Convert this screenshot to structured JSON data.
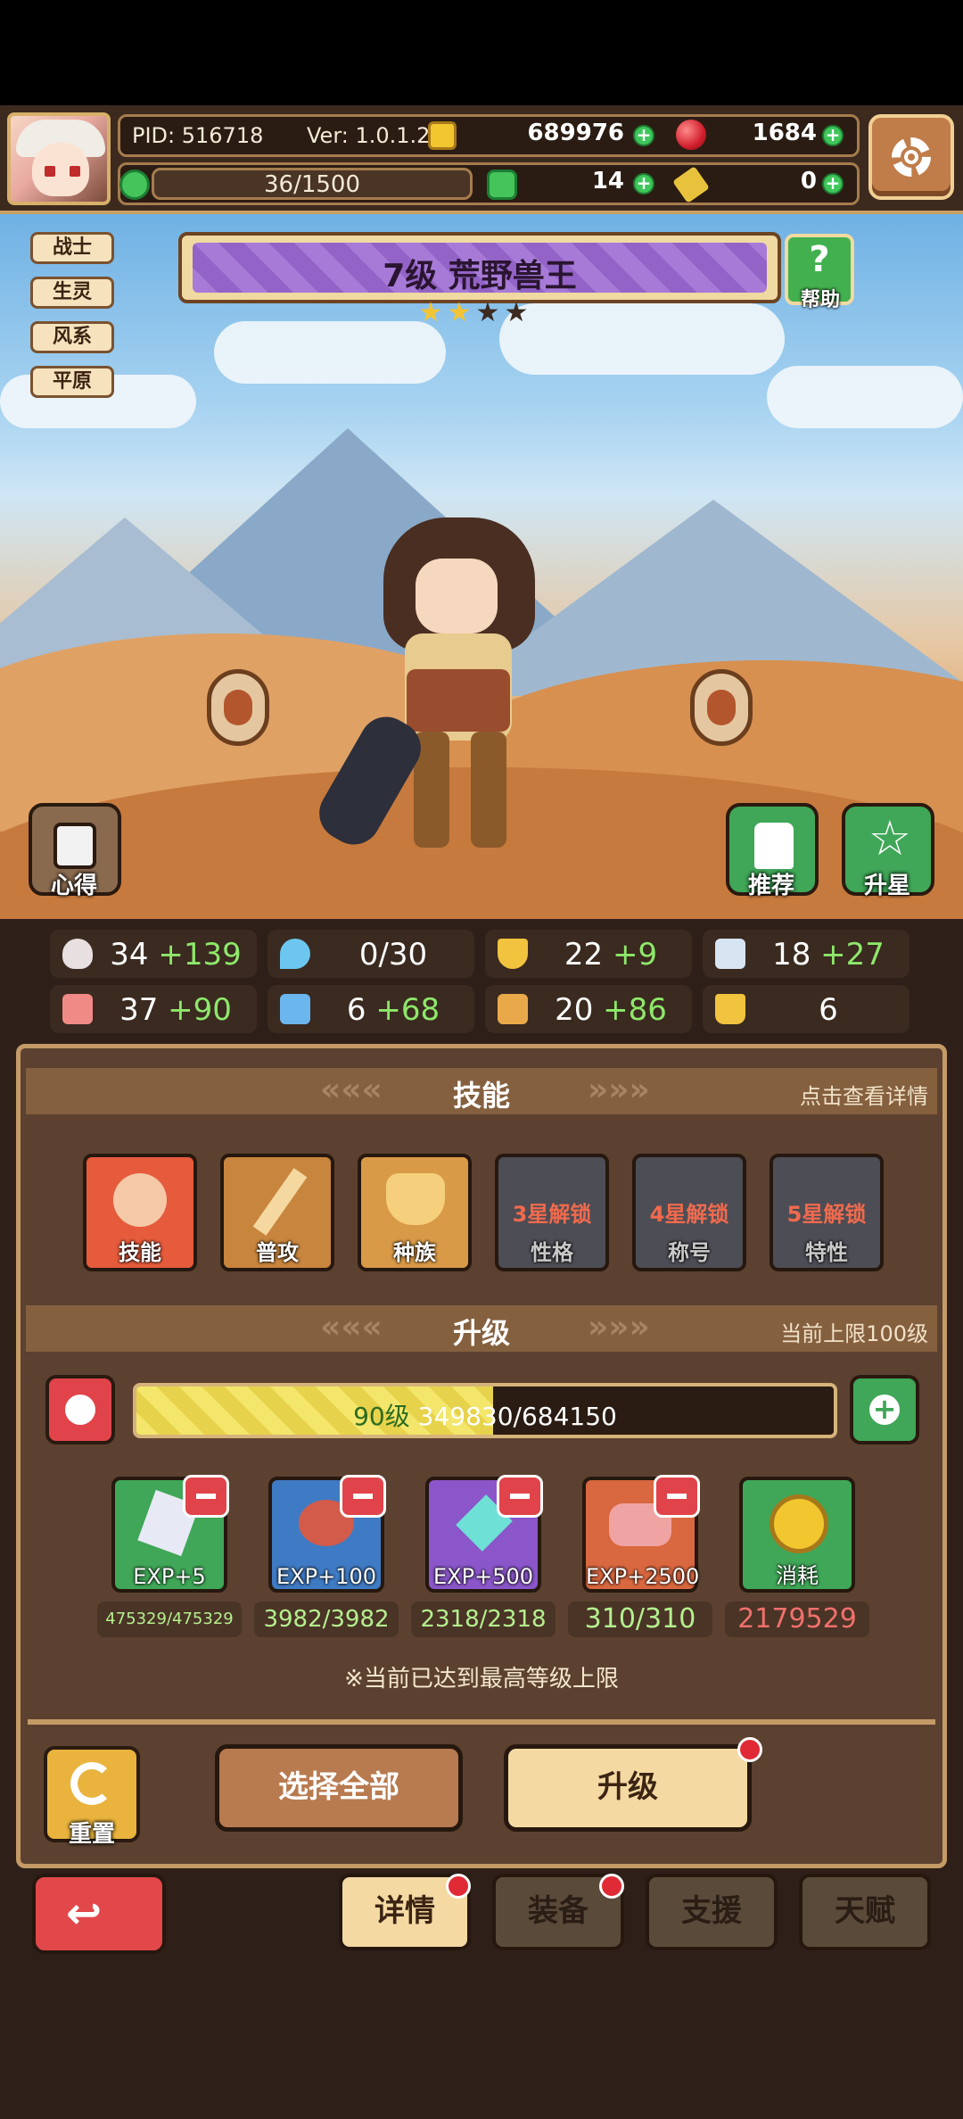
{
  "topbar": {
    "pid": "PID: 516718",
    "version": "Ver: 1.0.1.2",
    "gold": "689976",
    "gems": "1684",
    "stamina": "36/1500",
    "clovers": "14",
    "keys": "0"
  },
  "hero": {
    "tags": [
      "战士",
      "生灵",
      "风系",
      "平原"
    ],
    "title": "7级  荒野兽王",
    "help_label": "帮助",
    "help_icon": "?",
    "stars_filled": 2,
    "stars_total": 4,
    "left_button": "心得",
    "recommend_button": "推荐",
    "star_up_button": "升星"
  },
  "stats": [
    {
      "icon": "heart-icon",
      "base": "34",
      "bonus": "+139",
      "color": "#e8e0e0"
    },
    {
      "icon": "water-drop-icon",
      "base": "0/30",
      "bonus": "",
      "color": "#6cc6ef"
    },
    {
      "icon": "shield-icon",
      "base": "22",
      "bonus": "+9",
      "color": "#f1c33e"
    },
    {
      "icon": "speed-icon",
      "base": "18",
      "bonus": "+27",
      "color": "#d7e4f2"
    },
    {
      "icon": "fist-icon",
      "base": "37",
      "bonus": "+90",
      "color": "#f08a86"
    },
    {
      "icon": "book-icon",
      "base": "6",
      "bonus": "+68",
      "color": "#6cb6ef"
    },
    {
      "icon": "boot-icon",
      "base": "20",
      "bonus": "+86",
      "color": "#e9a94a"
    },
    {
      "icon": "crown-icon",
      "base": "6",
      "bonus": "",
      "color": "#f1c33e"
    }
  ],
  "skills_section": {
    "title": "技能",
    "hint": "点击查看详情",
    "items": [
      {
        "label": "技能",
        "lock": "",
        "color": "#e55b3c"
      },
      {
        "label": "普攻",
        "lock": "",
        "color": "#c8853d"
      },
      {
        "label": "种族",
        "lock": "",
        "color": "#d89a46"
      },
      {
        "label": "性格",
        "lock": "3星解锁",
        "color": "#4d4d55"
      },
      {
        "label": "称号",
        "lock": "4星解锁",
        "color": "#4d4d55"
      },
      {
        "label": "特性",
        "lock": "5星解锁",
        "color": "#4d4d55"
      }
    ]
  },
  "upgrade_section": {
    "title": "升级",
    "hint": "当前上限100级",
    "level_text": "90级",
    "exp_text": "349830/684150",
    "exp_progress": 0.511,
    "items": [
      {
        "label": "EXP+5",
        "count": "475329/475329",
        "color": "#3fa757",
        "icon": "crystal-icon"
      },
      {
        "label": "EXP+100",
        "count": "3982/3982",
        "color": "#3f7bc4",
        "icon": "meat-icon"
      },
      {
        "label": "EXP+500",
        "count": "2318/2318",
        "color": "#8a56c9",
        "icon": "ice-crystal-icon"
      },
      {
        "label": "EXP+2500",
        "count": "310/310",
        "color": "#d9673f",
        "icon": "steak-icon"
      },
      {
        "label": "消耗",
        "count": "2179529",
        "color": "#3fa757",
        "icon": "gold-coin-icon"
      }
    ],
    "max_note": "※当前已达到最高等级上限"
  },
  "actions": {
    "reset": "重置",
    "select_all": "选择全部",
    "upgrade": "升级"
  },
  "tabs": [
    "详情",
    "装备",
    "支援",
    "天赋"
  ]
}
